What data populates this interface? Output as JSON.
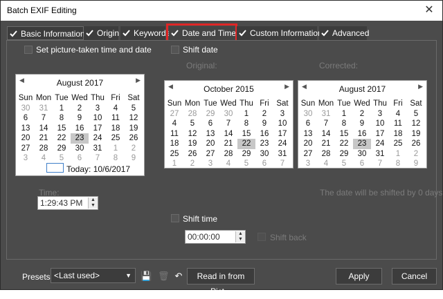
{
  "window": {
    "title": "Batch EXIF Editing",
    "close_glyph": "✕"
  },
  "tabs": [
    {
      "label": "Basic Information",
      "checked": true
    },
    {
      "label": "Origin",
      "checked": true
    },
    {
      "label": "Keywords",
      "checked": true
    },
    {
      "label": "Date and Time",
      "checked": true,
      "highlighted": true
    },
    {
      "label": "Custom Information",
      "checked": true
    },
    {
      "label": "Advanced",
      "checked": true
    }
  ],
  "date_time": {
    "set_picture_taken": {
      "label": "Set picture-taken time and date",
      "checked": false
    },
    "shift_date": {
      "label": "Shift date",
      "checked": false
    },
    "original_label": "Original:",
    "corrected_label": "Corrected:",
    "time_label": "Time:",
    "time_value": "1:29:43 PM",
    "today_label": "Today: 10/6/2017",
    "shift_message": "The date will be shifted by 0 days",
    "shift_time": {
      "label": "Shift time",
      "checked": false,
      "value": "00:00:00"
    },
    "shift_back": {
      "label": "Shift back",
      "checked": false
    }
  },
  "calendars": {
    "left": {
      "month": "August 2017",
      "weekdays": [
        "Sun",
        "Mon",
        "Tue",
        "Wed",
        "Thu",
        "Fri",
        "Sat"
      ],
      "days": [
        "30",
        "31",
        "1",
        "2",
        "3",
        "4",
        "5",
        "6",
        "7",
        "8",
        "9",
        "10",
        "11",
        "12",
        "13",
        "14",
        "15",
        "16",
        "17",
        "18",
        "19",
        "20",
        "21",
        "22",
        "23",
        "24",
        "25",
        "26",
        "27",
        "28",
        "29",
        "30",
        "31",
        "1",
        "2",
        "3",
        "4",
        "5",
        "6",
        "7",
        "8",
        "9"
      ],
      "muted": [
        0,
        1,
        33,
        34,
        35,
        36,
        37,
        38,
        39,
        40,
        41
      ],
      "selected": 24
    },
    "original": {
      "month": "October 2015",
      "weekdays": [
        "Sun",
        "Mon",
        "Tue",
        "Wed",
        "Thu",
        "Fri",
        "Sat"
      ],
      "days": [
        "27",
        "28",
        "29",
        "30",
        "1",
        "2",
        "3",
        "4",
        "5",
        "6",
        "7",
        "8",
        "9",
        "10",
        "11",
        "12",
        "13",
        "14",
        "15",
        "16",
        "17",
        "18",
        "19",
        "20",
        "21",
        "22",
        "23",
        "24",
        "25",
        "26",
        "27",
        "28",
        "29",
        "30",
        "31",
        "1",
        "2",
        "3",
        "4",
        "5",
        "6",
        "7"
      ],
      "muted": [
        0,
        1,
        2,
        3,
        35,
        36,
        37,
        38,
        39,
        40,
        41
      ],
      "selected": 25
    },
    "corrected": {
      "month": "August 2017",
      "weekdays": [
        "Sun",
        "Mon",
        "Tue",
        "Wed",
        "Thu",
        "Fri",
        "Sat"
      ],
      "days": [
        "30",
        "31",
        "1",
        "2",
        "3",
        "4",
        "5",
        "6",
        "7",
        "8",
        "9",
        "10",
        "11",
        "12",
        "13",
        "14",
        "15",
        "16",
        "17",
        "18",
        "19",
        "20",
        "21",
        "22",
        "23",
        "24",
        "25",
        "26",
        "27",
        "28",
        "29",
        "30",
        "31",
        "1",
        "2",
        "3",
        "4",
        "5",
        "6",
        "7",
        "8",
        "9"
      ],
      "muted": [
        0,
        1,
        33,
        34,
        35,
        36,
        37,
        38,
        39,
        40,
        41
      ],
      "selected": 24
    }
  },
  "footer": {
    "presets_label": "Presets:",
    "preset_value": "<Last used>",
    "read_button": "Read in from Pict...",
    "apply_button": "Apply",
    "cancel_button": "Cancel"
  },
  "colors": {
    "dialog_bg": "#4b4b4b",
    "highlight": "#e02626"
  }
}
